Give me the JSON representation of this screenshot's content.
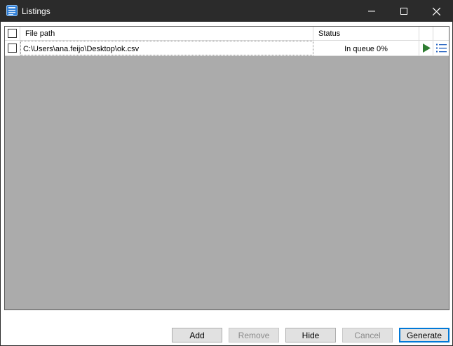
{
  "window": {
    "title": "Listings",
    "title_icon": "list-document-icon"
  },
  "grid": {
    "columns": [
      "File path",
      "Status"
    ],
    "rows": [
      {
        "checked": false,
        "path": "C:\\Users\\ana.feijo\\Desktop\\ok.csv",
        "status": "In queue 0%",
        "run_icon": "play-icon",
        "log_icon": "list-icon"
      }
    ]
  },
  "buttons": {
    "add": "Add",
    "remove": "Remove",
    "hide": "Hide",
    "cancel": "Cancel",
    "generate": "Generate"
  },
  "colors": {
    "titlebar": "#2b2b2b",
    "grid_background": "#ababab",
    "accent": "#0078d7",
    "play": "#2e7d32",
    "list_icon": "#1f5fbf"
  }
}
